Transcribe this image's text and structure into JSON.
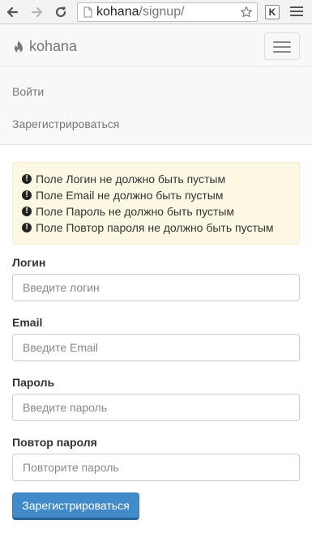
{
  "browser": {
    "url_domain": "kohana",
    "url_path": "/signup/",
    "extension_label": "K"
  },
  "navbar": {
    "brand": "kohana",
    "links": [
      {
        "label": "Войти"
      },
      {
        "label": "Зарегистрироваться"
      }
    ]
  },
  "alert": {
    "color": "#fcf8e3",
    "messages": [
      "Поле Логин не должно быть пустым",
      "Поле Email не должно быть пустым",
      "Поле Пароль не должно быть пустым",
      "Поле Повтор пароля не должно быть пустым"
    ]
  },
  "form": {
    "login": {
      "label": "Логин",
      "placeholder": "Введите логин",
      "value": ""
    },
    "email": {
      "label": "Email",
      "placeholder": "Введите Email",
      "value": ""
    },
    "password": {
      "label": "Пароль",
      "placeholder": "Введите пароль",
      "value": ""
    },
    "password_repeat": {
      "label": "Повтор пароля",
      "placeholder": "Повторите пароль",
      "value": ""
    },
    "submit_label": "Зарегистрироваться",
    "submit_color": "#428bca"
  },
  "icons": {
    "back": "arrow-left-icon",
    "forward": "arrow-right-icon",
    "reload": "reload-icon",
    "page": "page-icon",
    "bookmark": "star-icon",
    "brand": "fire-icon",
    "alert": "exclamation-sign-icon",
    "menu": "hamburger-icon"
  }
}
